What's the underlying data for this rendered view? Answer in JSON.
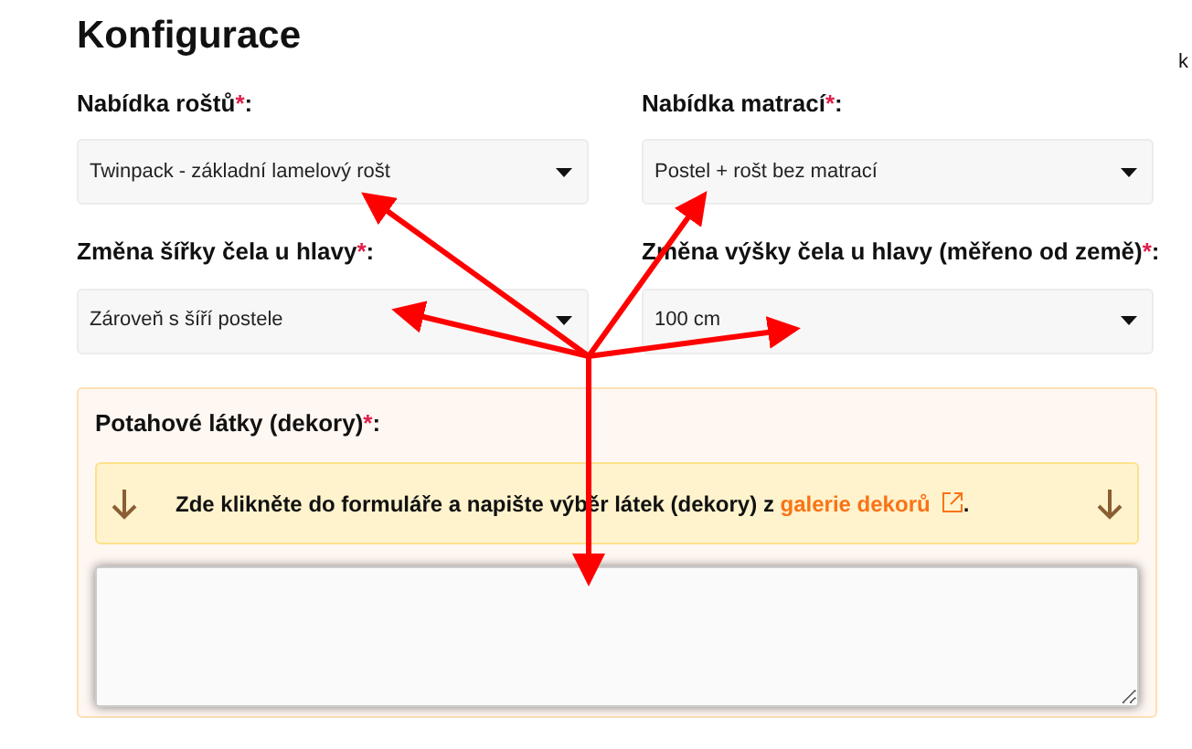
{
  "title": "Konfigurace",
  "edge_text": "k",
  "fields": [
    {
      "label": "Nabídka roštů",
      "required_mark": "*",
      "suffix": ":",
      "value": "Twinpack - základní lamelový rošt"
    },
    {
      "label": "Nabídka matrací",
      "required_mark": "*",
      "suffix": ":",
      "value": "Postel + rošt bez matrací"
    },
    {
      "label": "Změna šířky čela u hlavy",
      "required_mark": "*",
      "suffix": ":",
      "value": "Zároveň s šíří postele"
    },
    {
      "label": "Změna výšky čela u hlavy (měřeno od země)",
      "required_mark": "*",
      "suffix": ":",
      "value": "100 cm"
    }
  ],
  "fabrics": {
    "label": "Potahové látky (dekory)",
    "required_mark": "*",
    "suffix": ":",
    "notice": {
      "text": "Zde klikněte do formuláře a napište výběr látek (dekory) z ",
      "link": "galerie dekorů",
      "end": "."
    }
  }
}
